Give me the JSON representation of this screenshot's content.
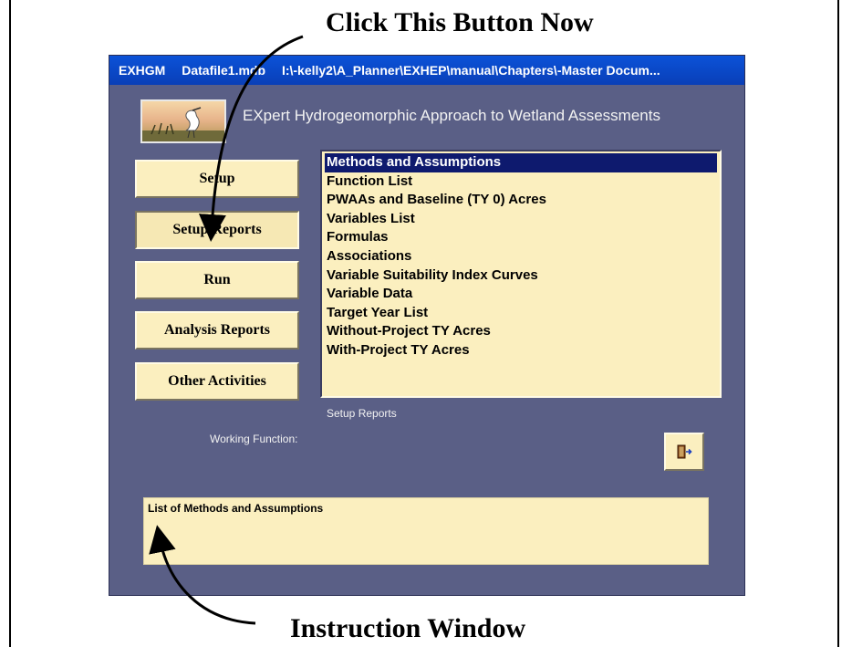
{
  "annotations": {
    "top": "Click This Button Now",
    "bottom": "Instruction Window"
  },
  "window": {
    "title_parts": [
      "EXHGM",
      "Datafile1.mdb",
      "I:\\-kelly2\\A_Planner\\EXHEP\\manual\\Chapters\\-Master Docum..."
    ],
    "heading": "EXpert Hydrogeomorphic Approach to Wetland Assessments",
    "logo_icon": "heron-wetland-logo"
  },
  "nav": {
    "setup": "Setup",
    "setup_reports": "Setup Reports",
    "run": "Run",
    "analysis_reports": "Analysis Reports",
    "other_activities": "Other Activities"
  },
  "reports": {
    "items": [
      "Methods and Assumptions",
      "Function List",
      "PWAAs and Baseline (TY 0) Acres",
      "Variables List",
      "Formulas",
      "Associations",
      "Variable Suitability Index Curves",
      "Variable Data",
      "Target Year List",
      "Without-Project TY Acres",
      "With-Project TY Acres"
    ],
    "selected_index": 0,
    "caption": "Setup Reports"
  },
  "working_function_label": "Working Function:",
  "exit_icon": "exit-door-icon",
  "instruction_text": "List of Methods and Assumptions",
  "colors": {
    "window_bg": "#5a5f86",
    "panel_bg": "#fbefbf",
    "title_bar": "#0b52d8",
    "selection": "#0e1a6e"
  }
}
